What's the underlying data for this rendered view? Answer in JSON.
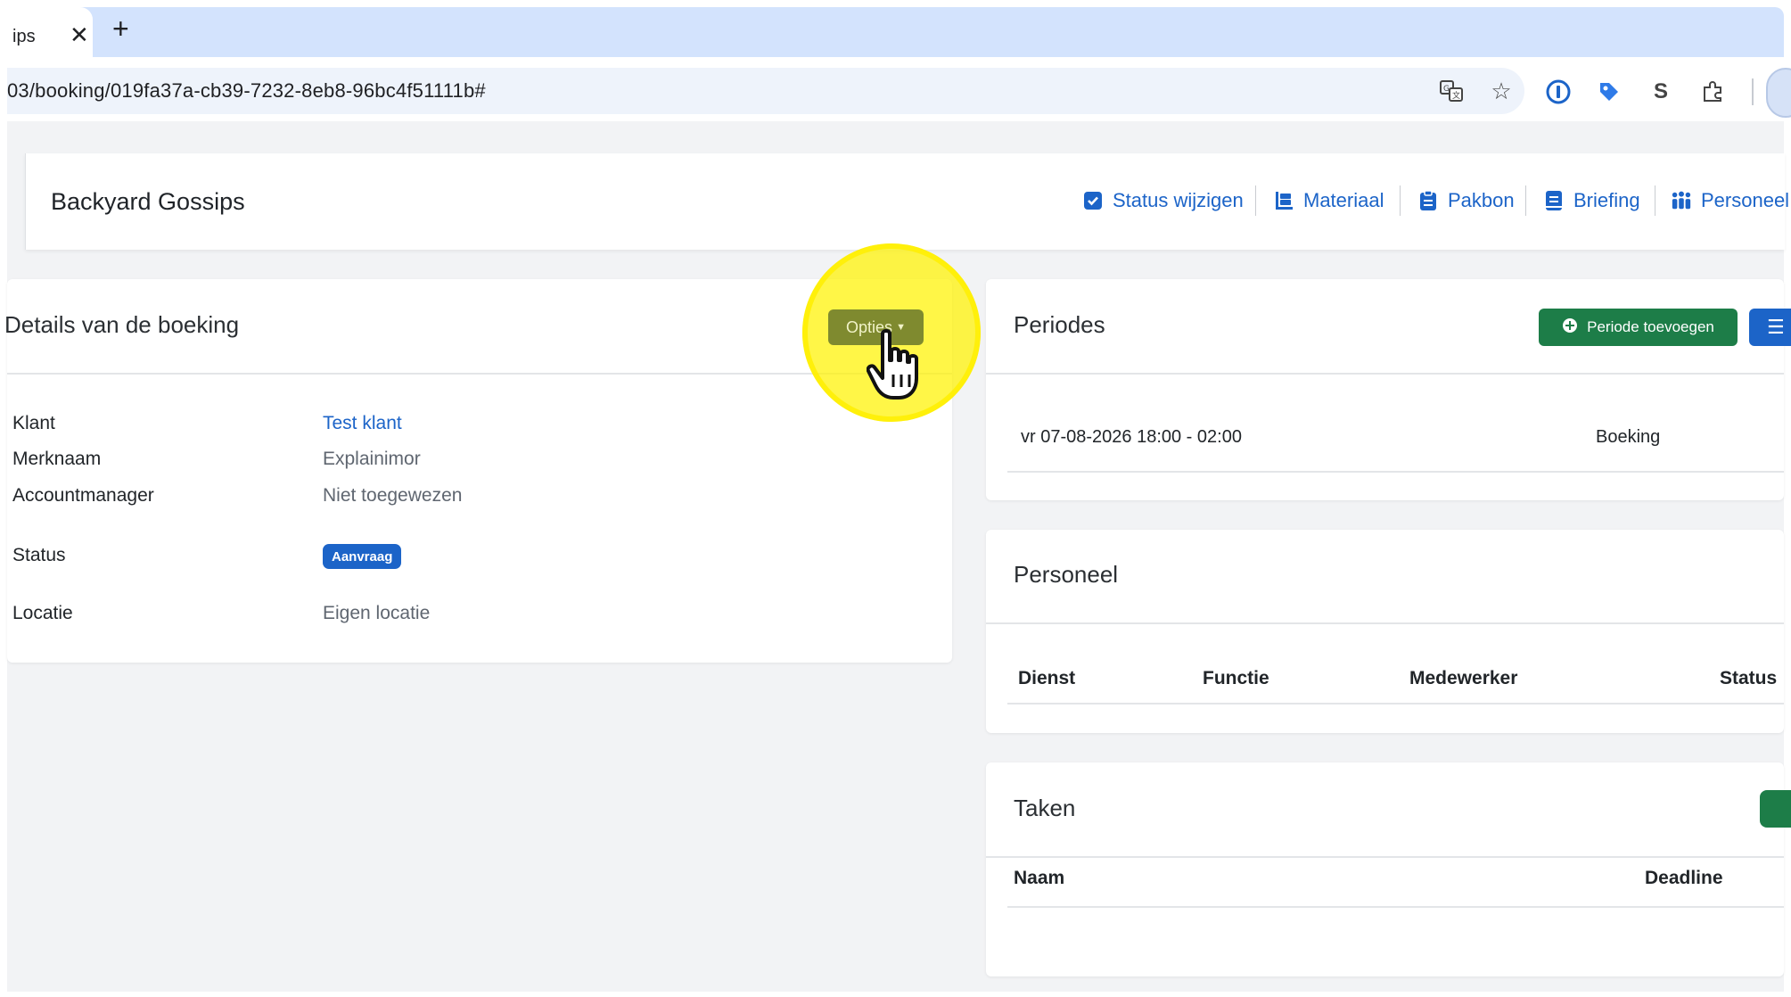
{
  "browser": {
    "tab_title": "ips",
    "tab_close": "✕",
    "new_tab": "+",
    "url": "03/booking/019fa37a-cb39-7232-8eb8-96bc4f51111b#"
  },
  "header": {
    "title": "Backyard Gossips",
    "links": [
      {
        "label": "Status wijzigen",
        "icon": "check-square-icon"
      },
      {
        "label": "Materiaal",
        "icon": "dolly-icon"
      },
      {
        "label": "Pakbon",
        "icon": "clipboard-icon"
      },
      {
        "label": "Briefing",
        "icon": "book-icon"
      },
      {
        "label": "Personeel",
        "icon": "people-icon"
      }
    ]
  },
  "details": {
    "title": "Details van de boeking",
    "options_label": "Opties",
    "fields": [
      {
        "label": "Klant",
        "value": "Test klant"
      },
      {
        "label": "Merknaam",
        "value": "Explainimor"
      },
      {
        "label": "Accountmanager",
        "value": "Niet toegewezen"
      },
      {
        "label": "Status",
        "value": "Aanvraag"
      },
      {
        "label": "Locatie",
        "value": "Eigen locatie"
      }
    ]
  },
  "periodes": {
    "title": "Periodes",
    "add_label": "Periode toevoegen",
    "rows": [
      {
        "period": "vr 07-08-2026 18:00 - 02:00",
        "type": "Boeking"
      }
    ]
  },
  "personeel": {
    "title": "Personeel",
    "columns": [
      "Dienst",
      "Functie",
      "Medewerker",
      "Status"
    ]
  },
  "taken": {
    "title": "Taken",
    "columns": [
      "Naam",
      "Deadline"
    ]
  },
  "colors": {
    "primary": "#1c64c8",
    "success": "#1d7d48",
    "highlight": "#fff200"
  }
}
